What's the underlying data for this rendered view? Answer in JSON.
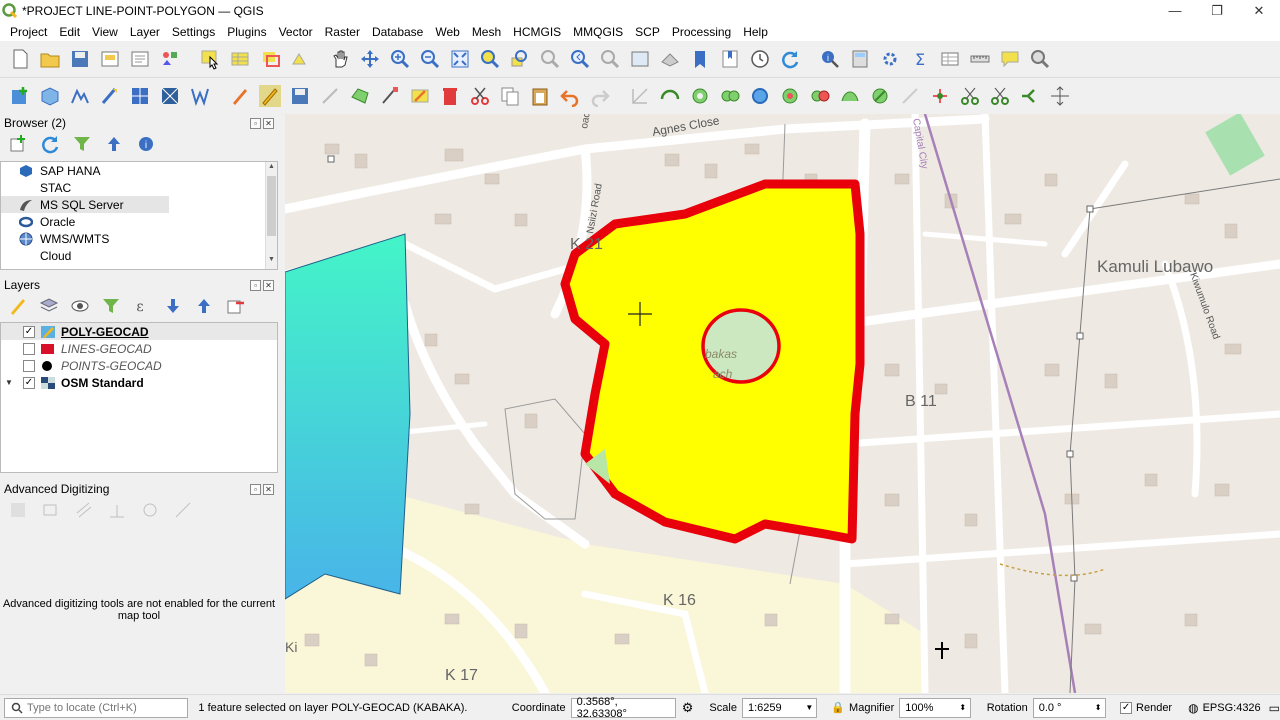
{
  "window": {
    "title": "*PROJECT LINE-POINT-POLYGON — QGIS",
    "controls": [
      "—",
      "❐",
      "✕"
    ]
  },
  "menubar": [
    "Project",
    "Edit",
    "View",
    "Layer",
    "Settings",
    "Plugins",
    "Vector",
    "Raster",
    "Database",
    "Web",
    "Mesh",
    "HCMGIS",
    "MMQGIS",
    "SCP",
    "Processing",
    "Help"
  ],
  "browser": {
    "title": "Browser (2)",
    "items": [
      {
        "label": "SAP HANA",
        "icon": "sap-hana-icon"
      },
      {
        "label": "STAC",
        "icon": "stac-icon"
      },
      {
        "label": "MS SQL Server",
        "icon": "mssql-icon",
        "selected": true
      },
      {
        "label": "Oracle",
        "icon": "oracle-icon"
      },
      {
        "label": "WMS/WMTS",
        "icon": "wms-icon"
      },
      {
        "label": "Cloud",
        "icon": "cloud-icon"
      }
    ]
  },
  "layers": {
    "title": "Layers",
    "items": [
      {
        "name": "POLY-GEOCAD",
        "checked": true,
        "symbol": "polygon-edit-icon",
        "active": true
      },
      {
        "name": "LINES-GEOCAD",
        "checked": false,
        "symbol": "line-icon",
        "active": false
      },
      {
        "name": "POINTS-GEOCAD",
        "checked": false,
        "symbol": "point-icon",
        "active": false
      },
      {
        "name": "OSM Standard",
        "checked": true,
        "symbol": "raster-tile-icon",
        "active": true,
        "expand": true
      }
    ]
  },
  "advanced_digitizing": {
    "title": "Advanced Digitizing",
    "message": "Advanced digitizing tools are not enabled for the current map tool"
  },
  "map": {
    "labels": {
      "agnes_close": "Agnes Close",
      "nsiizi_road": "Nsiizi Road",
      "k21": "K 21",
      "kamuli": "Kamuli Lubawo",
      "kiwumulo": "Kiwumulo Road",
      "b11": "B 11",
      "k16": "K 16",
      "k17": "K 17",
      "capital_city": "Capital City",
      "kabaka_a": "bakas",
      "kabaka_b": "ach",
      "ki": "Ki"
    },
    "colors": {
      "polygon_fill": "#ffff00",
      "polygon_stroke": "#e8000b",
      "cyan_top": "#44f5c8",
      "cyan_bottom": "#48b4e8",
      "base": "#eeeae3",
      "road": "#ffffff",
      "railway": "#a780b8",
      "residential": "#faf6d8"
    }
  },
  "statusbar": {
    "locate_placeholder": "Type to locate (Ctrl+K)",
    "message": "1 feature selected on layer POLY-GEOCAD (KABAKA).",
    "coordinate_label": "Coordinate",
    "coordinate_value": "0.3568°, 32.63308°",
    "scale_label": "Scale",
    "scale_value": "1:6259",
    "magnifier_label": "Magnifier",
    "magnifier_value": "100%",
    "rotation_label": "Rotation",
    "rotation_value": "0.0 °",
    "render_label": "Render",
    "crs": "EPSG:4326"
  }
}
